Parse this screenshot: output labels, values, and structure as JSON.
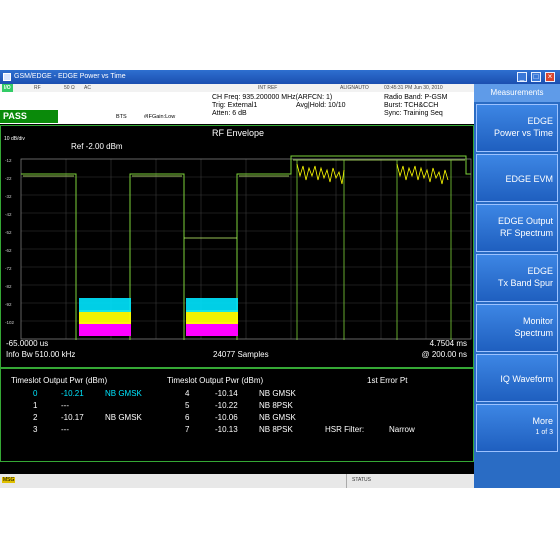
{
  "window": {
    "title": "GSM/EDGE - EDGE Power vs Time"
  },
  "status_bar": {
    "io": "I/O",
    "rf": "RF",
    "impedance": "50 Ω",
    "coupling": "AC",
    "int_ref": "INT REF",
    "align": "ALIGNAUTO",
    "datetime": "03:45:31 PM Jun 30, 2010"
  },
  "info": {
    "pass": "PASS",
    "bts": "BTS",
    "if_gain": "#IFGain:Low",
    "ch_freq": "CH Freq: 935.200000 MHz(ARFCN: 1)",
    "trig": "Trig: External1",
    "avg_hold": "Avg|Hold: 10/10",
    "atten": "Atten: 6 dB",
    "radio_band": "Radio Band: P-GSM",
    "burst": "Burst: TCH&CCH",
    "sync": "Sync: Training Seq"
  },
  "graph": {
    "title": "RF Envelope",
    "scale": "10 dB/div",
    "ref": "Ref  -2.00 dBm",
    "y_ticks": [
      "-12",
      "-22",
      "-32",
      "-42",
      "-52",
      "-62",
      "-72",
      "-82",
      "-92",
      "-102"
    ],
    "start": "-65.0000 us",
    "info_bw": "Info Bw 510.00 kHz",
    "samples": "24077 Samples",
    "stop": "4.7504 ms",
    "resolution": "@ 200.00 ns"
  },
  "table": {
    "header_left": "Timeslot Output Pwr (dBm)",
    "header_mid": "Timeslot Output Pwr (dBm)",
    "header_right": "1st Error Pt",
    "rows_left": [
      {
        "slot": "0",
        "pwr": "-10.21",
        "mod": "NB GMSK"
      },
      {
        "slot": "1",
        "pwr": "---",
        "mod": ""
      },
      {
        "slot": "2",
        "pwr": "-10.17",
        "mod": "NB GMSK"
      },
      {
        "slot": "3",
        "pwr": "---",
        "mod": ""
      }
    ],
    "rows_right": [
      {
        "slot": "4",
        "pwr": "-10.14",
        "mod": "NB GMSK"
      },
      {
        "slot": "5",
        "pwr": "-10.22",
        "mod": "NB 8PSK"
      },
      {
        "slot": "6",
        "pwr": "-10.06",
        "mod": "NB GMSK"
      },
      {
        "slot": "7",
        "pwr": "-10.13",
        "mod": "NB 8PSK"
      }
    ],
    "hsr_filter_label": "HSR Filter:",
    "hsr_filter_value": "Narrow"
  },
  "softkeys": {
    "header": "Measurements",
    "k1a": "EDGE",
    "k1b": "Power vs Time",
    "k2": "EDGE EVM",
    "k3a": "EDGE Output",
    "k3b": "RF Spectrum",
    "k4a": "EDGE",
    "k4b": "Tx Band Spur",
    "k5a": "Monitor",
    "k5b": "Spectrum",
    "k6": "IQ Waveform",
    "k7a": "More",
    "k7b": "1 of 3"
  },
  "bottom": {
    "msg": "MSG",
    "status": "STATUS"
  },
  "colors": {
    "trace": "#7dd23a",
    "envelope_yellow": "#ffff00",
    "cyan": "#00e5ff",
    "magenta": "#ff00ff",
    "softkey_blue": "#2a6cc4"
  }
}
